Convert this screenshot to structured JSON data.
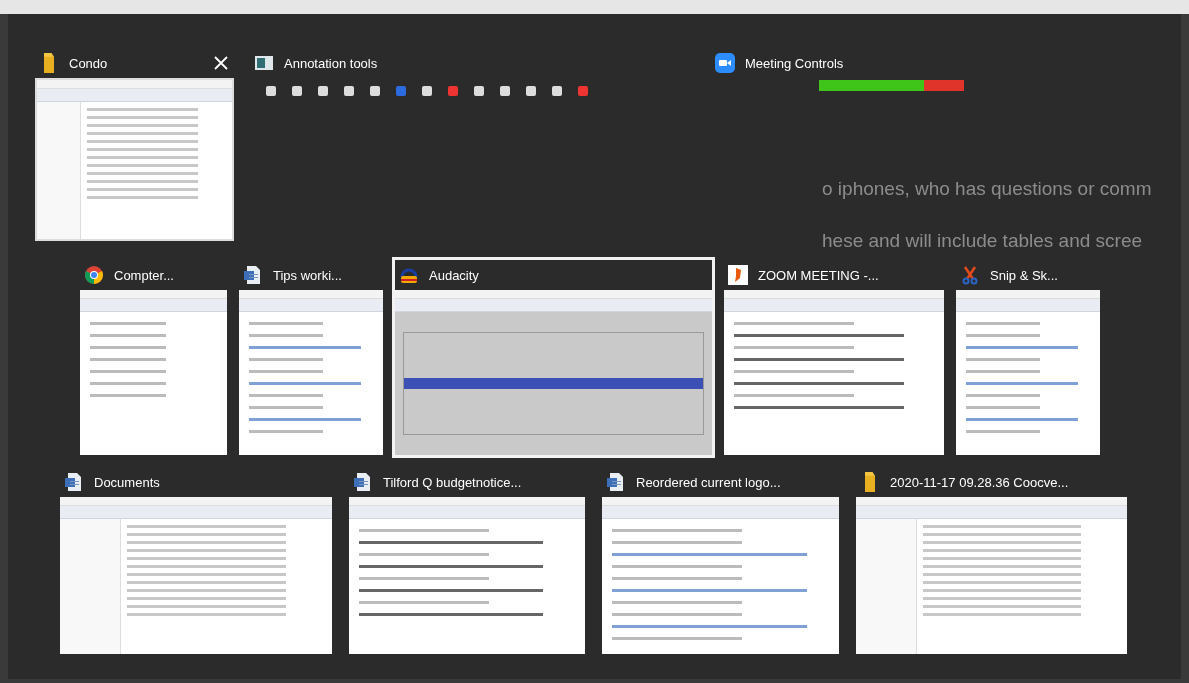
{
  "background_document": {
    "lines": [
      "o iphones, who has questions or comm",
      "hese and will include tables and scree"
    ]
  },
  "rows": [
    {
      "windows": [
        {
          "title": "Condo",
          "kind": "folder",
          "thumbnail": {
            "kind": "explorer"
          },
          "selected": false,
          "hovered": true
        },
        {
          "title": "Annotation tools",
          "kind": "panel",
          "thumbnail": {
            "kind": "toolbar"
          },
          "selected": false,
          "hovered": false
        },
        {
          "title": "Meeting Controls",
          "kind": "video",
          "thumbnail": {
            "kind": "bar"
          },
          "selected": false,
          "hovered": false
        }
      ]
    },
    {
      "windows": [
        {
          "title": "Compter...",
          "kind": "browser",
          "thumbnail": {
            "kind": "note"
          },
          "selected": false,
          "hovered": false
        },
        {
          "title": "Tips worki...",
          "kind": "document",
          "thumbnail": {
            "kind": "doc"
          },
          "selected": false,
          "hovered": false
        },
        {
          "title": "Audacity",
          "kind": "audio",
          "thumbnail": {
            "kind": "audio"
          },
          "selected": true,
          "hovered": false
        },
        {
          "title": "ZOOM MEETING -...",
          "kind": "reader",
          "thumbnail": {
            "kind": "form"
          },
          "selected": false,
          "hovered": false
        },
        {
          "title": "Snip & Sk...",
          "kind": "snip",
          "thumbnail": {
            "kind": "doc"
          },
          "selected": false,
          "hovered": false
        }
      ]
    },
    {
      "windows": [
        {
          "title": "Documents",
          "kind": "document",
          "thumbnail": {
            "kind": "explorer"
          },
          "selected": false,
          "hovered": false
        },
        {
          "title": "Tilford Q budgetnotice...",
          "kind": "document",
          "thumbnail": {
            "kind": "form"
          },
          "selected": false,
          "hovered": false
        },
        {
          "title": "Reordered current logo...",
          "kind": "document",
          "thumbnail": {
            "kind": "doc"
          },
          "selected": false,
          "hovered": false
        },
        {
          "title": "2020-11-17 09.28.36 Coocve...",
          "kind": "folder",
          "thumbnail": {
            "kind": "explorer"
          },
          "selected": false,
          "hovered": false
        }
      ]
    }
  ]
}
